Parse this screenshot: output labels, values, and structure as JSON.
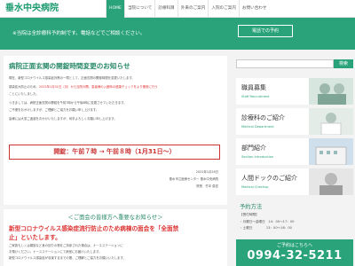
{
  "header": {
    "logo": "垂水中央病院",
    "nav": [
      "HOME",
      "当院について",
      "診療科目",
      "外来のご案内",
      "入院のご案内",
      "お問い合わせ"
    ]
  },
  "banner": {
    "text": "※当院は全診療科予約制です。電話などでご相談ください。",
    "button": "電話での予約"
  },
  "notice": {
    "title": "病院正面玄関の開錠時間変更のお知らせ",
    "lines": [
      "現在、新型コロナウイルス感染症対策の一環として、正面玄関の開錠時間を変更いたします。",
      "感染拡大防止のため、",
      "2022年1月31日（月）から当院の開、患者様の入館時の健康チェックをより徹底に行う",
      "ことにいたしました。",
      "つきましては、病院正面玄関の開錠を午前7時から午後8時に変更させていただきます。",
      "ご不便をおかけしますが、ご理解とご協力をお願い申し上げます。",
      "皆様には大変ご迷惑をおかけいたしますが、何卒よろしくお願い申し上げます。"
    ],
    "highlight": "開錠：午前７時 → 午前８時（1月31日～）",
    "date": "2022年1月28日",
    "org": "垂水市立医療センター 垂水中央病院",
    "sig": "院長　竹中 俊宏"
  },
  "notice2": {
    "title": "＜ご面会の皆様方へ重要なお知らせ＞",
    "headline1": "新型コロナウイルス感染症流行防止",
    "headline2": "のため病棟の面会を「全面禁",
    "headline3": "止」といたします。",
    "lines": [
      "ご家族もしくは親族など身の回りの物をご持参された場合は、ナースステーションに",
      "お預けください。ナースステーションにて病室にお届けいたします。",
      "新型コロナウイルス感染症が収束するまでの間、ご理解とご協力をお願いいたします。"
    ]
  },
  "sidebar": {
    "search_placeholder": "",
    "search_button": "検索",
    "cards": [
      {
        "title": "職員募集",
        "sub": "Staff Recruitment"
      },
      {
        "title": "診療科のご紹介",
        "sub": "Medical Department"
      },
      {
        "title": "部門紹介",
        "sub": "Section Introduction"
      },
      {
        "title": "人間ドックのご紹介",
        "sub": "Medical Checkup"
      }
    ],
    "reservation": {
      "title": "予約方法",
      "l1": "【受付時間】",
      "l2": "・月曜日～金曜日　14：00～17：00",
      "l3": "・土曜日　　　　 13：00～16：00"
    },
    "tel": {
      "label": "ご予約はこちらへ",
      "number": "0994-32-5211"
    }
  }
}
